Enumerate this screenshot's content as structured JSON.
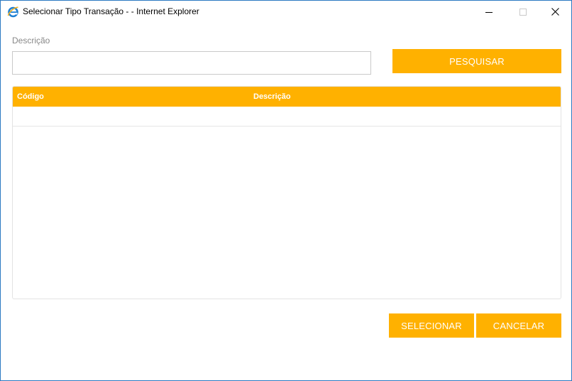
{
  "window": {
    "title": "Selecionar Tipo Transação - - Internet Explorer",
    "icon": "internet-explorer-icon",
    "border_color": "#2b79c2"
  },
  "form": {
    "description_label": "Descrição",
    "description_value": "",
    "search_button": "PESQUISAR"
  },
  "grid": {
    "columns": [
      "Código",
      "Descrição"
    ],
    "rows": []
  },
  "footer": {
    "select_button": "SELECIONAR",
    "cancel_button": "CANCELAR"
  },
  "theme": {
    "accent": "#ffb100"
  }
}
